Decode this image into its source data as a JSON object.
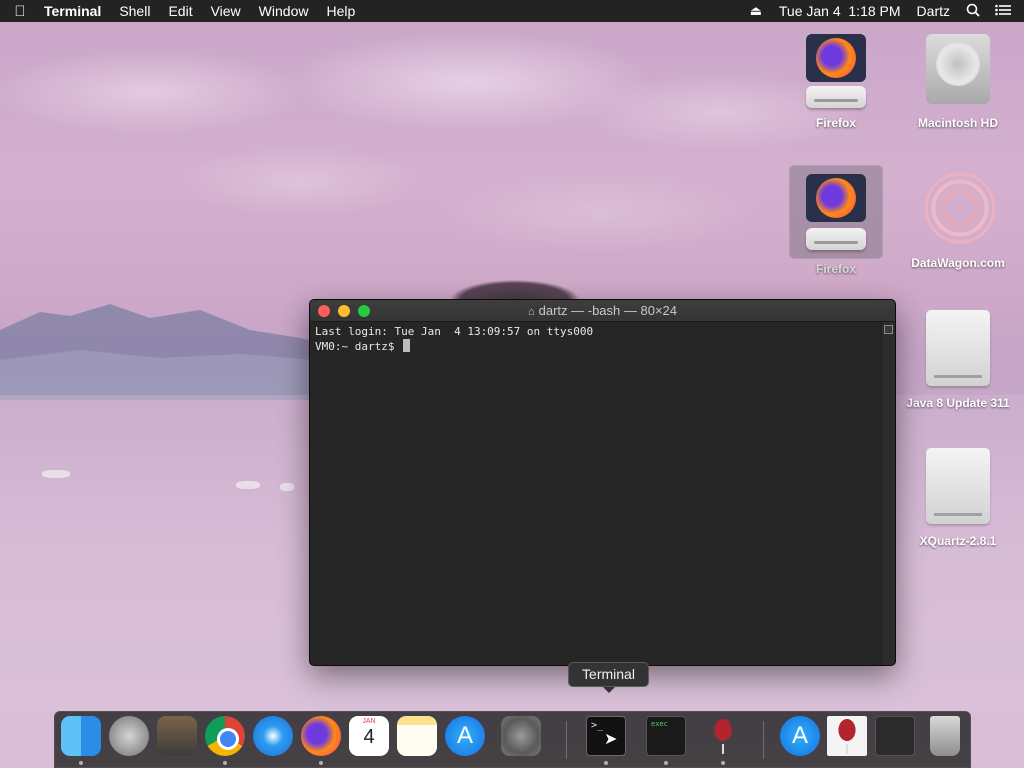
{
  "menubar": {
    "app_name": "Terminal",
    "items": [
      "Shell",
      "Edit",
      "View",
      "Window",
      "Help"
    ],
    "clock": "Tue Jan 4  1:18 PM",
    "user": "Dartz"
  },
  "desktop_icons": [
    {
      "label": "Firefox"
    },
    {
      "label": "Macintosh HD"
    },
    {
      "label": "Firefox"
    },
    {
      "label": "DataWagon.com"
    },
    {
      "label": "Java 8 Update 311"
    },
    {
      "label": "XQuartz-2.8.1"
    }
  ],
  "terminal": {
    "title": "dartz — -bash — 80×24",
    "lines": [
      "Last login: Tue Jan  4 13:09:57 on ttys000",
      "VM0:~ dartz$ "
    ]
  },
  "tooltip": "Terminal",
  "dock": {
    "calendar_month": "JAN",
    "calendar_day": "4",
    "terminal_prompt": ">_",
    "exec_label": "exec",
    "appstore_glyph": "A"
  },
  "icons": {
    "apple": "apple-icon",
    "eject": "eject-icon",
    "spotlight": "search-icon",
    "notification": "list-icon"
  }
}
